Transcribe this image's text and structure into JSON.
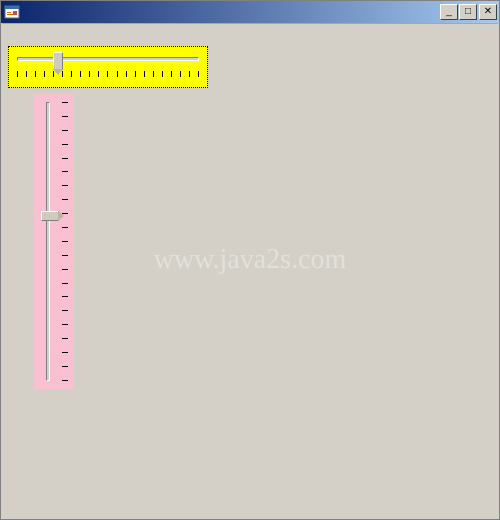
{
  "window": {
    "title": "",
    "caption": {
      "minimize": "_",
      "maximize": "□",
      "close": "✕"
    }
  },
  "client": {
    "bg_color": "#d4d0c8"
  },
  "h_trackbar": {
    "bg_color": "#ffff00",
    "min": 0,
    "max": 10,
    "value": 2,
    "tick_count": 21,
    "focused": true
  },
  "v_trackbar": {
    "bg_color": "#f8c0d0",
    "min": 0,
    "max": 20,
    "value": 8,
    "tick_count": 21,
    "focused": false
  },
  "watermark": {
    "text": "www.java2s.com"
  }
}
